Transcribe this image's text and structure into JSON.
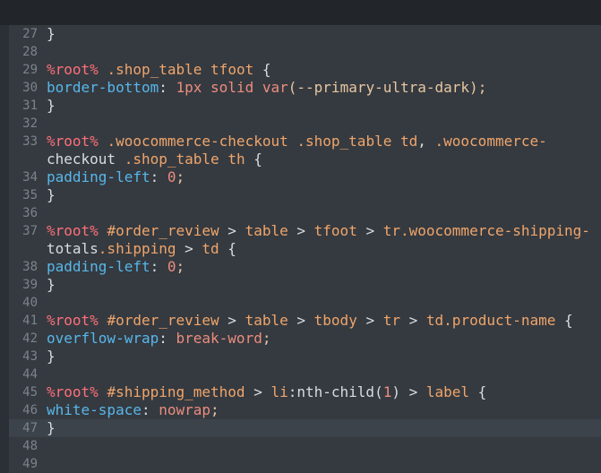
{
  "lines": [
    {
      "n": "27",
      "code": "}"
    },
    {
      "n": "28",
      "code": ""
    },
    {
      "n": "29",
      "code": "%root% .shop_table tfoot {"
    },
    {
      "n": "30",
      "code": "border-bottom: 1px solid var(--primary-ultra-dark);"
    },
    {
      "n": "31",
      "code": "}"
    },
    {
      "n": "32",
      "code": ""
    },
    {
      "n": "33",
      "code": "%root% .woocommerce-checkout .shop_table td, .woocommerce-"
    },
    {
      "n": "",
      "code": "checkout .shop_table th {"
    },
    {
      "n": "34",
      "code": "padding-left: 0;"
    },
    {
      "n": "35",
      "code": "}"
    },
    {
      "n": "36",
      "code": ""
    },
    {
      "n": "37",
      "code": "%root% #order_review > table > tfoot > tr.woocommerce-shipping-"
    },
    {
      "n": "",
      "code": "totals.shipping > td {"
    },
    {
      "n": "38",
      "code": "padding-left: 0;"
    },
    {
      "n": "39",
      "code": "}"
    },
    {
      "n": "40",
      "code": ""
    },
    {
      "n": "41",
      "code": "%root% #order_review > table > tbody > tr > td.product-name {"
    },
    {
      "n": "42",
      "code": "overflow-wrap: break-word;"
    },
    {
      "n": "43",
      "code": "}"
    },
    {
      "n": "44",
      "code": ""
    },
    {
      "n": "45",
      "code": "%root% #shipping_method > li:nth-child(1) > label {"
    },
    {
      "n": "46",
      "code": "white-space: nowrap;"
    },
    {
      "n": "47",
      "code": "}"
    },
    {
      "n": "48",
      "code": ""
    },
    {
      "n": "49",
      "code": ""
    }
  ],
  "active_line": "47",
  "colors": {
    "background": "#2b2f36",
    "editor": "#353a40",
    "placeholder": "#ff6f7a",
    "selector": "#f0a56b",
    "property": "#57b7ea",
    "value": "#ec8c7e"
  }
}
